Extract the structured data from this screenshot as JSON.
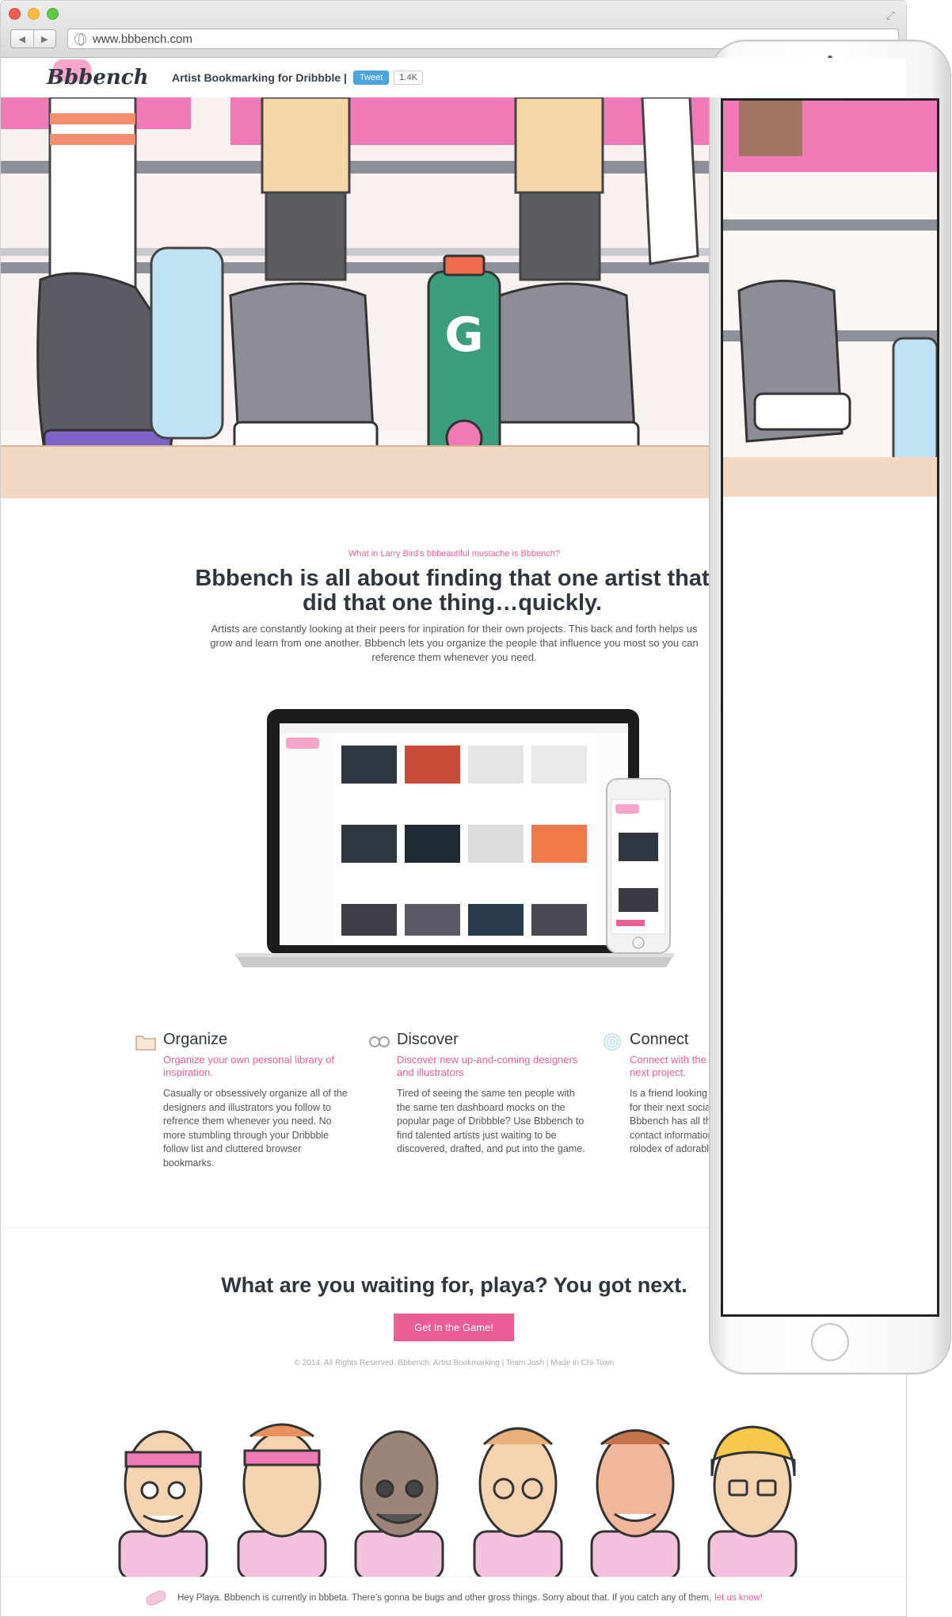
{
  "browser": {
    "url": "www.bbbench.com",
    "back_glyph": "◀",
    "forward_glyph": "▶",
    "expand_glyph": "⤢"
  },
  "header": {
    "logo": "Bbbench",
    "tagline": "Artist Bookmarking for Dribbble |",
    "tweet_label": "Tweet",
    "tweet_count": "1.4K"
  },
  "intro": {
    "eyebrow": "What in Larry Bird’s bbbeautiful mustache is Bbbench?",
    "headline": "Bbbench is all about finding that one artist that did that one thing…quickly.",
    "body": "Artists are constantly looking at their peers for inpiration for their own projects. This back and forth helps us grow and learn from one another. Bbbench lets you organize the people that influence you most so you can reference them whenever you need."
  },
  "features": [
    {
      "icon": "folder-icon",
      "title": "Organize",
      "subtitle": "Organize your own personal library of inspiration.",
      "body": "Casually or obsessively organize all of the designers and illustrators you follow to refrence them whenever you need. No more stumbling through your Dribbble follow list and cluttered browser bookmarks."
    },
    {
      "icon": "glasses-icon",
      "title": "Discover",
      "subtitle": "Discover new up-and-coming designers and illustrators",
      "body": "Tired of seeing the same ten people with the same ten dashboard mocks on the popular page of Dribbble? Use Bbbench to find talented artists just waiting to be discovered, drafted, and put into the game."
    },
    {
      "icon": "fingerprint-icon",
      "title": "Connect",
      "subtitle": "Connect with the perfect artist for your next project.",
      "body": "Is a friend looking for a product designer for their next social media startup? Bbbench has all the portfolio links and contact information you need; it’s like a rolodex of adorable business cards."
    }
  ],
  "cta": {
    "title": "What are you waiting for, playa? You got next.",
    "button": "Get In the Game!",
    "footer": "© 2014. All Rights Reserved. Bbbench: Artist Bookmarking | Team Josh | Made in Chi-Town"
  },
  "notice": {
    "text": "Hey Playa. Bbbench is currently in bbbeta. There’s gonna be bugs and other gross things. Sorry about that. If you catch any of them,",
    "link": "let us know!"
  },
  "colors": {
    "accent": "#ea5d95",
    "dark": "#2f3640",
    "twitter": "#4ba4dd"
  }
}
